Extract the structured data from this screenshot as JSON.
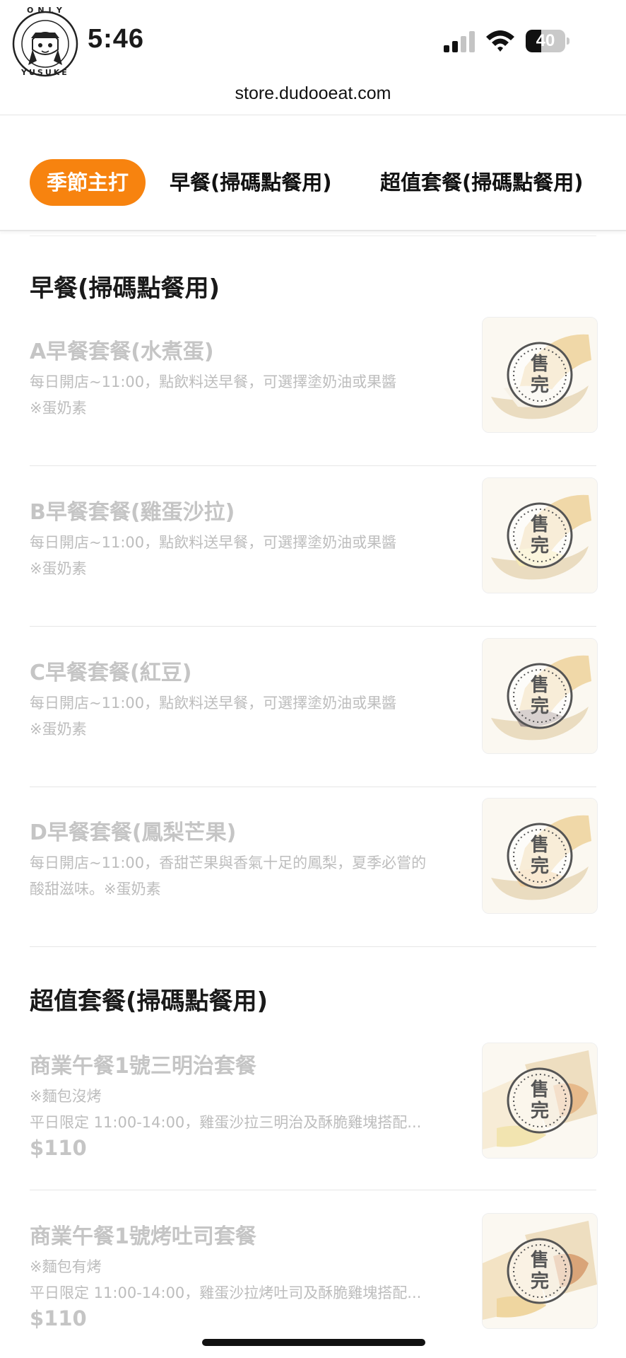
{
  "status_bar": {
    "time": "5:46",
    "battery": 40,
    "url": "store.dudooeat.com",
    "avatar_text_top": "ONLY",
    "avatar_text_bottom": "YUSUKE"
  },
  "tabs": [
    {
      "label": "季節主打",
      "active": true
    },
    {
      "label": "早餐(掃碼點餐用)",
      "active": false
    },
    {
      "label": "超值套餐(掃碼點餐用)",
      "active": false
    }
  ],
  "sections": {
    "breakfast": {
      "title": "早餐(掃碼點餐用)",
      "items": [
        {
          "name": "A早餐套餐(水煮蛋)",
          "desc1": "每日開店~11:00，點飲料送早餐，可選擇塗奶油或果醬",
          "desc2": "※蛋奶素",
          "sold_out": "售完"
        },
        {
          "name": "B早餐套餐(雞蛋沙拉)",
          "desc1": "每日開店~11:00，點飲料送早餐，可選擇塗奶油或果醬",
          "desc2": "※蛋奶素",
          "sold_out": "售完"
        },
        {
          "name": "C早餐套餐(紅豆)",
          "desc1": "每日開店~11:00，點飲料送早餐，可選擇塗奶油或果醬",
          "desc2": "※蛋奶素",
          "sold_out": "售完"
        },
        {
          "name": "D早餐套餐(鳳梨芒果)",
          "desc1": "每日開店~11:00，香甜芒果與香氣十足的鳳梨，夏季必嘗的",
          "desc2": "酸甜滋味。※蛋奶素",
          "sold_out": "售完"
        }
      ]
    },
    "value_sets": {
      "title": "超值套餐(掃碼點餐用)",
      "items": [
        {
          "name": "商業午餐1號三明治套餐",
          "desc1": "※麵包沒烤",
          "desc2": "平日限定 11:00-14:00，雞蛋沙拉三明治及酥脆雞塊搭配...",
          "price": "$110",
          "sold_out": "售完"
        },
        {
          "name": "商業午餐1號烤吐司套餐",
          "desc1": "※麵包有烤",
          "desc2": "平日限定 11:00-14:00，雞蛋沙拉烤吐司及酥脆雞塊搭配...",
          "price": "$110",
          "sold_out": "售完"
        }
      ]
    }
  },
  "colors": {
    "accent": "#f7830f",
    "disabled_text": "#c5c5c5"
  }
}
